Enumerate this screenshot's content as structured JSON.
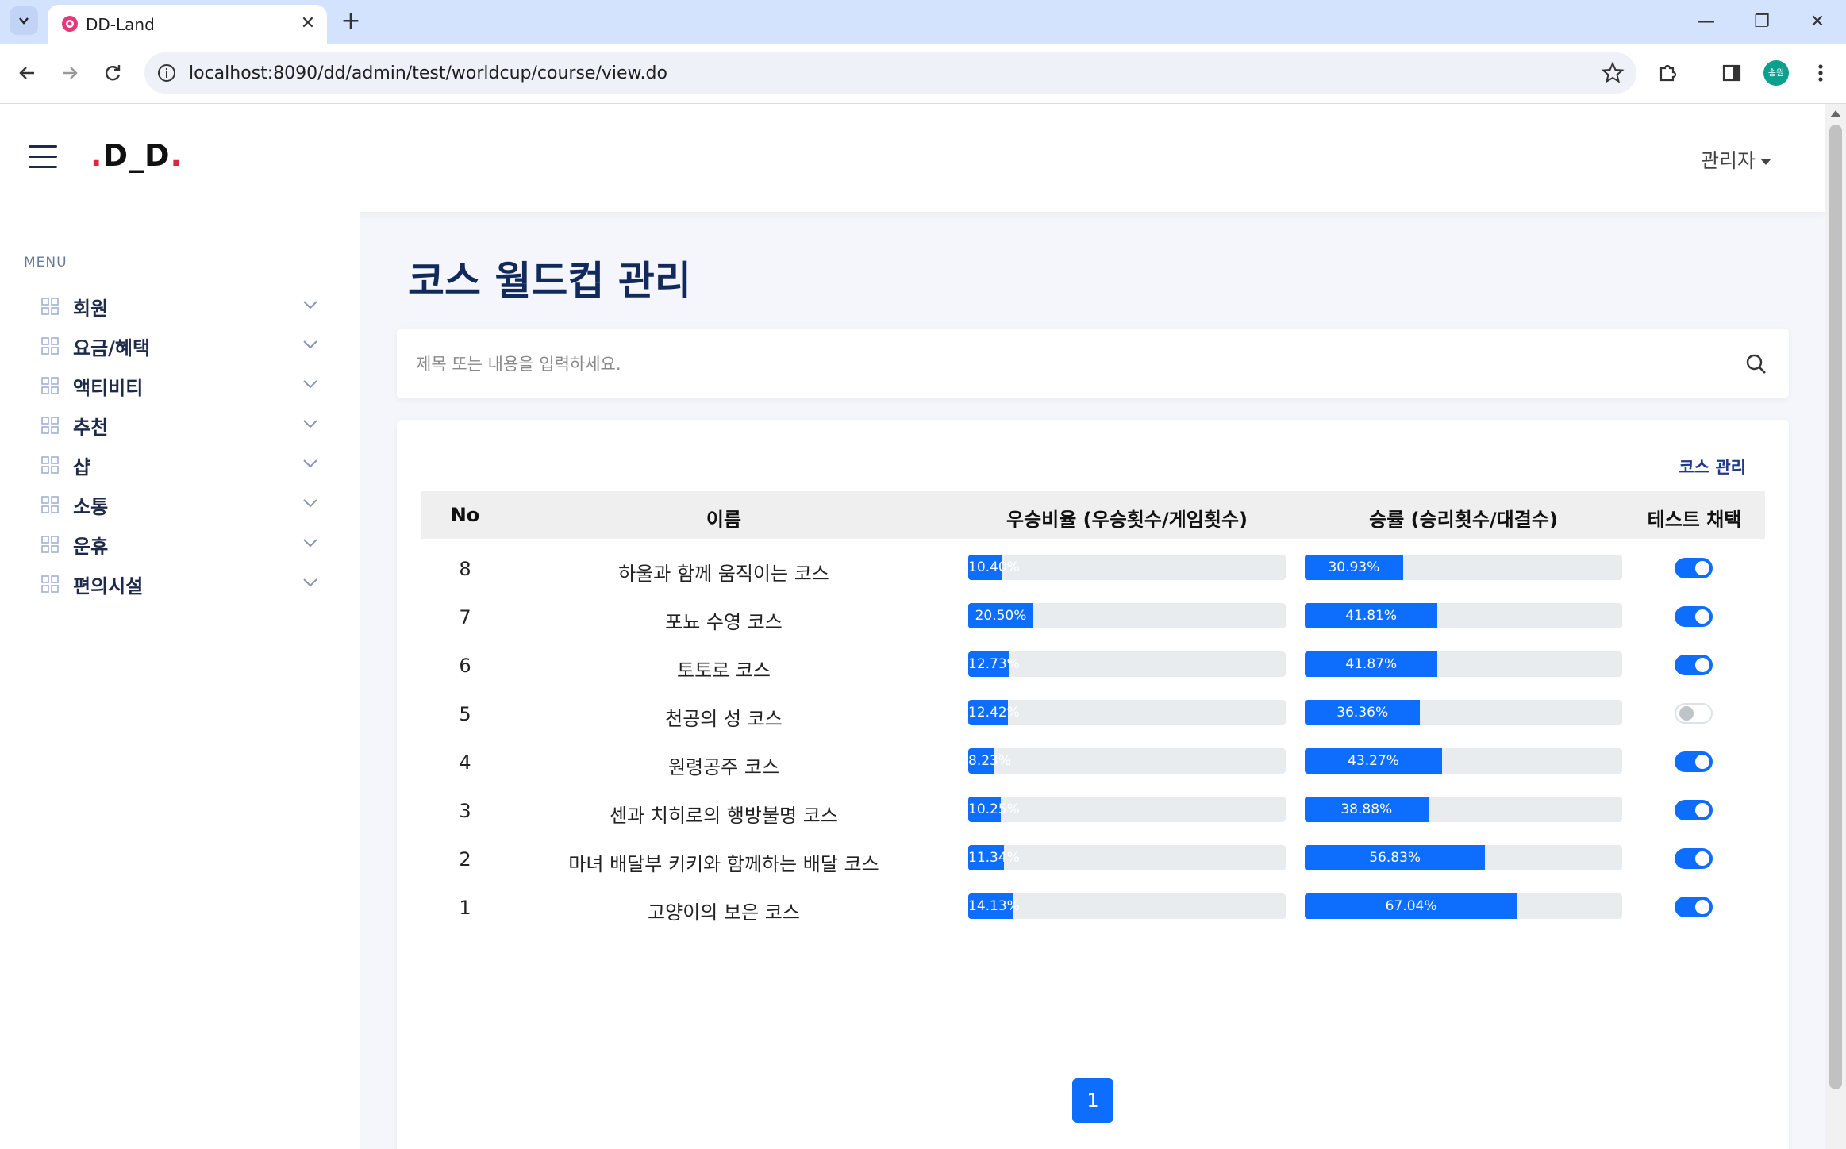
{
  "browser": {
    "tab_title": "DD-Land",
    "url": "localhost:8090/dd/admin/test/worldcup/course/view.do",
    "profile_initials": "송원"
  },
  "header": {
    "logo_prefix": ".",
    "logo_text": "D_D",
    "logo_suffix": ".",
    "admin_label": "관리자"
  },
  "sidebar": {
    "caption": "MENU",
    "items": [
      {
        "label": "회원"
      },
      {
        "label": "요금/혜택"
      },
      {
        "label": "액티비티"
      },
      {
        "label": "추천"
      },
      {
        "label": "샵"
      },
      {
        "label": "소통"
      },
      {
        "label": "운휴"
      },
      {
        "label": "편의시설"
      }
    ]
  },
  "main": {
    "title": "코스 월드컵 관리",
    "search_placeholder": "제목 또는 내용을 입력하세요.",
    "course_manage_label": "코스 관리",
    "columns": {
      "no": "No",
      "name": "이름",
      "win_ratio": "우승비율 (우승횟수/게임횟수)",
      "win_rate": "승률 (승리횟수/대결수)",
      "adopt": "테스트 채택"
    },
    "rows": [
      {
        "no": "8",
        "name": "하울과 함께 움직이는 코스",
        "win_ratio": "10.40%",
        "win_ratio_value": 10.4,
        "win_rate": "30.93%",
        "win_rate_value": 30.93,
        "adopted": true
      },
      {
        "no": "7",
        "name": "포뇨 수영 코스",
        "win_ratio": "20.50%",
        "win_ratio_value": 20.5,
        "win_rate": "41.81%",
        "win_rate_value": 41.81,
        "adopted": true
      },
      {
        "no": "6",
        "name": "토토로 코스",
        "win_ratio": "12.73%",
        "win_ratio_value": 12.73,
        "win_rate": "41.87%",
        "win_rate_value": 41.87,
        "adopted": true
      },
      {
        "no": "5",
        "name": "천공의 성 코스",
        "win_ratio": "12.42%",
        "win_ratio_value": 12.42,
        "win_rate": "36.36%",
        "win_rate_value": 36.36,
        "adopted": false
      },
      {
        "no": "4",
        "name": "원령공주 코스",
        "win_ratio": "8.23%",
        "win_ratio_value": 8.23,
        "win_rate": "43.27%",
        "win_rate_value": 43.27,
        "adopted": true
      },
      {
        "no": "3",
        "name": "센과 치히로의 행방불명 코스",
        "win_ratio": "10.25%",
        "win_ratio_value": 10.25,
        "win_rate": "38.88%",
        "win_rate_value": 38.88,
        "adopted": true
      },
      {
        "no": "2",
        "name": "마녀 배달부 키키와 함께하는 배달 코스",
        "win_ratio": "11.34%",
        "win_ratio_value": 11.34,
        "win_rate": "56.83%",
        "win_rate_value": 56.83,
        "adopted": true
      },
      {
        "no": "1",
        "name": "고양이의 보은 코스",
        "win_ratio": "14.13%",
        "win_ratio_value": 14.13,
        "win_rate": "67.04%",
        "win_rate_value": 67.04,
        "adopted": true
      }
    ],
    "pagination": [
      "1"
    ]
  },
  "colors": {
    "accent": "#0d6efd",
    "title": "#122a5a",
    "logo_dot": "#e0263b"
  }
}
